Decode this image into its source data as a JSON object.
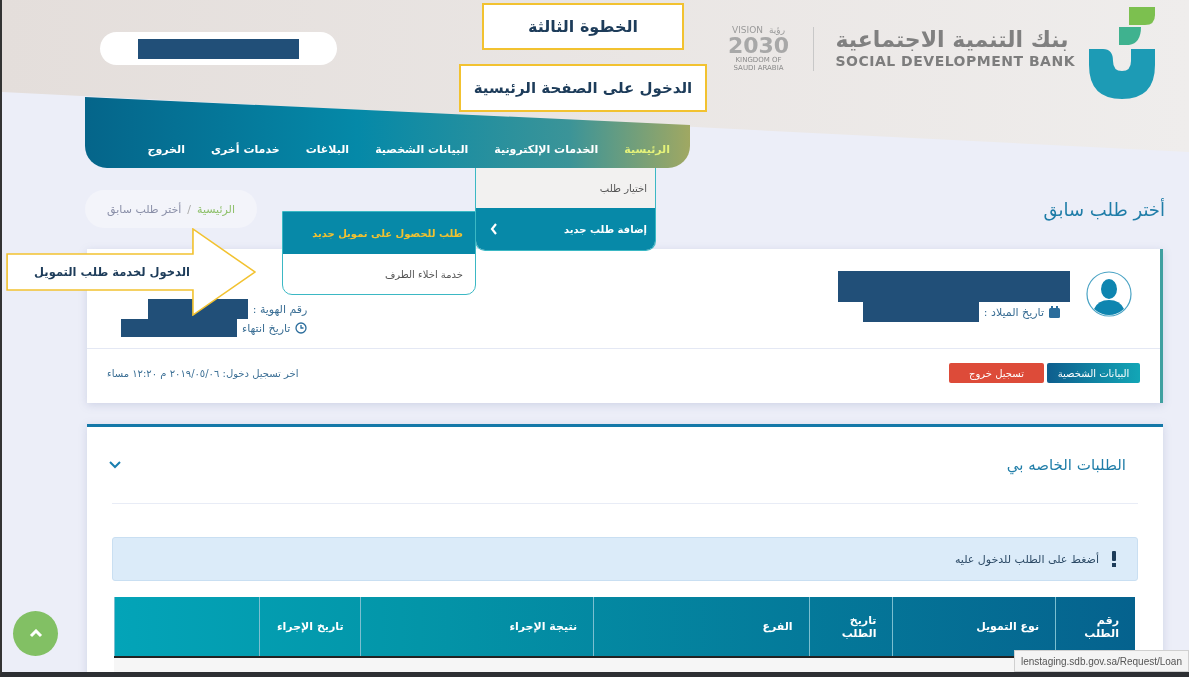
{
  "callouts": [
    {
      "kind": "box",
      "text": "الخطوة الثالثة"
    },
    {
      "kind": "box",
      "text": "الدخول على الصفحة الرئيسية"
    },
    {
      "kind": "arrow",
      "text": "الدخول لخدمة طلب التمويل"
    }
  ],
  "logo": {
    "name_ar": "بنك التنمية الاجتماعية",
    "name_en": "SOCIAL DEVELOPMENT BANK"
  },
  "vision": {
    "label_ar": "رؤية",
    "label_en": "VISION",
    "year": "2030",
    "caption": "KINGDOM OF SAUDI ARABIA"
  },
  "nav": [
    {
      "label": "الرئيسية",
      "selected": true
    },
    {
      "label": "الخدمات الإلكترونية",
      "selected": false
    },
    {
      "label": "البيانات الشخصية",
      "selected": false
    },
    {
      "label": "البلاغات",
      "selected": false
    },
    {
      "label": "خدمات أخرى",
      "selected": false
    },
    {
      "label": "الخروج",
      "selected": false
    }
  ],
  "dropdown": [
    {
      "label": "اختيار طلب",
      "selected": false
    },
    {
      "label": "إضافة طلب جديد",
      "selected": true
    }
  ],
  "submenu": [
    {
      "label": "طلب للحصول على تمويل جديد",
      "selected": true
    },
    {
      "label": "خدمة اخلاء الطرف",
      "selected": false
    }
  ],
  "breadcrumb": {
    "items": [
      {
        "label": "الرئيسية",
        "selected": false
      },
      {
        "label": "أختر طلب سابق",
        "selected": true
      }
    ],
    "separator": "/"
  },
  "page_title": "أختر طلب سابق",
  "profile": {
    "birth_label": "تاريخ الميلاد :",
    "id_label": "رقم الهوية :",
    "expiry_label": "تاريخ انتهاء",
    "buttons": [
      {
        "label": "البيانات الشخصية",
        "kind": "primary"
      },
      {
        "label": "تسجيل خروج",
        "kind": "danger"
      }
    ],
    "last_login": "اخر تسجيل دخول: ٢٠١٩/٠٥/٠٦ م ١٢:٢٠ مساء"
  },
  "requests": {
    "title": "الطلبات الخاصه بي",
    "hint": "أضغط على الطلب للدخول عليه",
    "columns": [
      "رقم الطلب",
      "نوع التمويل",
      "تاريخ الطلب",
      "الفرع",
      "نتيجة الإجراء",
      "تاريخ الإجراء",
      ""
    ]
  },
  "status_url": "lenstaging.sdb.gov.sa/Request/Loan"
}
